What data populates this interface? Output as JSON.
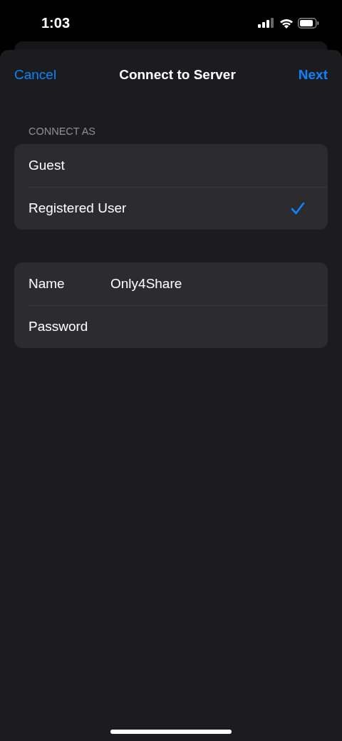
{
  "status_bar": {
    "time": "1:03"
  },
  "nav": {
    "cancel": "Cancel",
    "title": "Connect to Server",
    "next": "Next"
  },
  "connect_as": {
    "header": "CONNECT AS",
    "options": [
      {
        "label": "Guest",
        "selected": false
      },
      {
        "label": "Registered User",
        "selected": true
      }
    ]
  },
  "fields": [
    {
      "label": "Name",
      "kind": "text",
      "value": "Only4Share"
    },
    {
      "label": "Password",
      "kind": "password"
    }
  ]
}
